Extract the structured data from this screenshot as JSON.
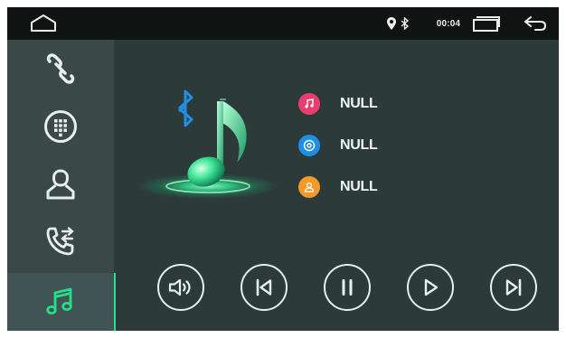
{
  "status_bar": {
    "time": "00:04",
    "icons": [
      "home-icon",
      "location-icon",
      "bluetooth-icon",
      "recent-apps-icon",
      "back-icon"
    ]
  },
  "sidebar": {
    "items": [
      {
        "name": "link",
        "icon": "link-icon",
        "active": false
      },
      {
        "name": "keypad",
        "icon": "dialpad-icon",
        "active": false
      },
      {
        "name": "contacts",
        "icon": "contact-icon",
        "active": false
      },
      {
        "name": "call-log",
        "icon": "call-transfer-icon",
        "active": false
      },
      {
        "name": "music",
        "icon": "music-icon",
        "active": true
      }
    ]
  },
  "track": {
    "title": "NULL",
    "album": "NULL",
    "artist": "NULL"
  },
  "controls": [
    "volume-icon",
    "previous-icon",
    "pause-icon",
    "play-icon",
    "next-icon"
  ],
  "colors": {
    "accent": "#25e08b",
    "background": "#2c3a39",
    "status_bar": "#0f1413",
    "sidebar": "#3a4948",
    "title_dot": "#ea3f6e",
    "album_dot": "#1f8fe6",
    "artist_dot": "#f59a2a",
    "bluetooth": "#1f8fe6"
  }
}
